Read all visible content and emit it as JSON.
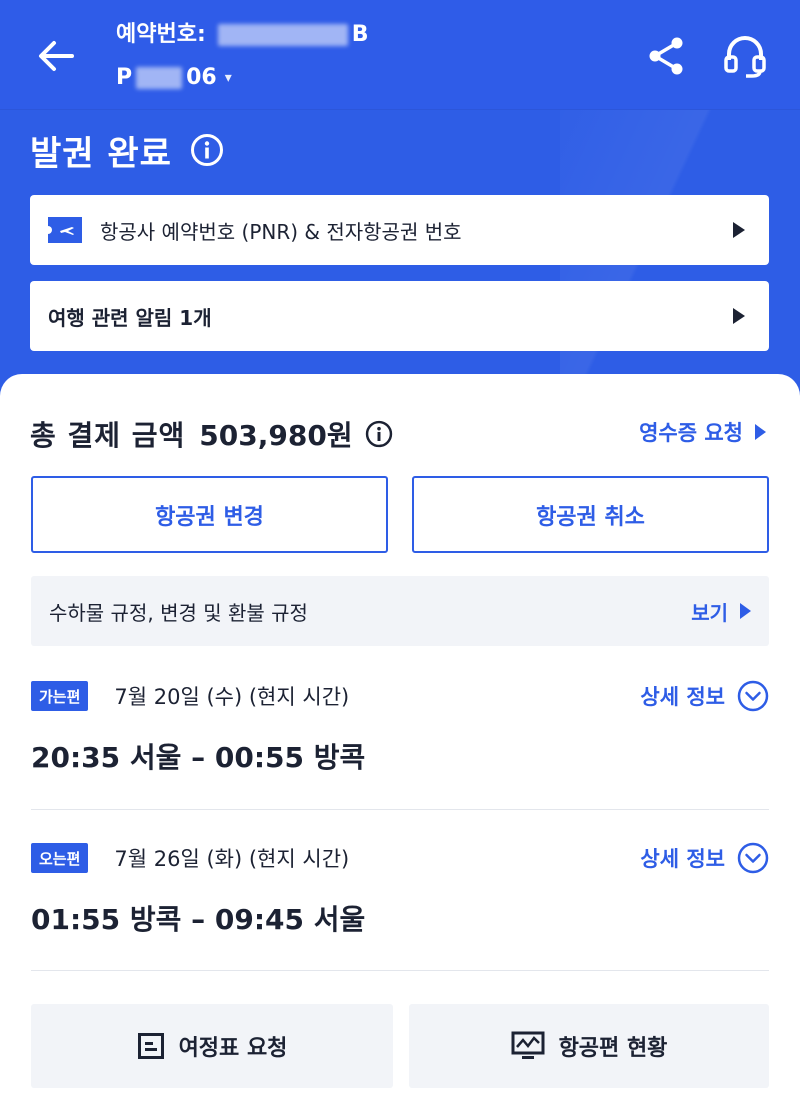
{
  "header": {
    "booking_label": "예약번호:",
    "booking_suffix": "B",
    "pnr_prefix": "P",
    "pnr_suffix": "06",
    "back_icon": "back-arrow-icon",
    "share_icon": "share-icon",
    "support_icon": "headset-icon"
  },
  "status": {
    "title": "발권 완료"
  },
  "cards": {
    "pnr_label": "항공사 예약번호 (PNR) & 전자항공권 번호",
    "alert_label": "여행 관련 알림 1개"
  },
  "payment": {
    "label": "총 결제 금액",
    "amount": "503,980원",
    "receipt_link": "영수증 요청"
  },
  "actions": {
    "change_ticket": "항공권 변경",
    "cancel_ticket": "항공권 취소"
  },
  "rules": {
    "text": "수하물 규정, 변경 및 환불 규정",
    "view": "보기"
  },
  "legs": [
    {
      "badge": "가는편",
      "date": "7월 20일 (수) (현지 시간)",
      "detail": "상세 정보",
      "route": "20:35 서울 – 00:55 방콕"
    },
    {
      "badge": "오는편",
      "date": "7월 26일 (화) (현지 시간)",
      "detail": "상세 정보",
      "route": "01:55 방콕 – 09:45 서울"
    }
  ],
  "bottom": {
    "itinerary": "여정표 요청",
    "flight_status": "항공편 현황"
  },
  "colors": {
    "brand_blue": "#2e5de6",
    "text_dark": "#1c2233",
    "panel_gray": "#f2f4f8"
  }
}
